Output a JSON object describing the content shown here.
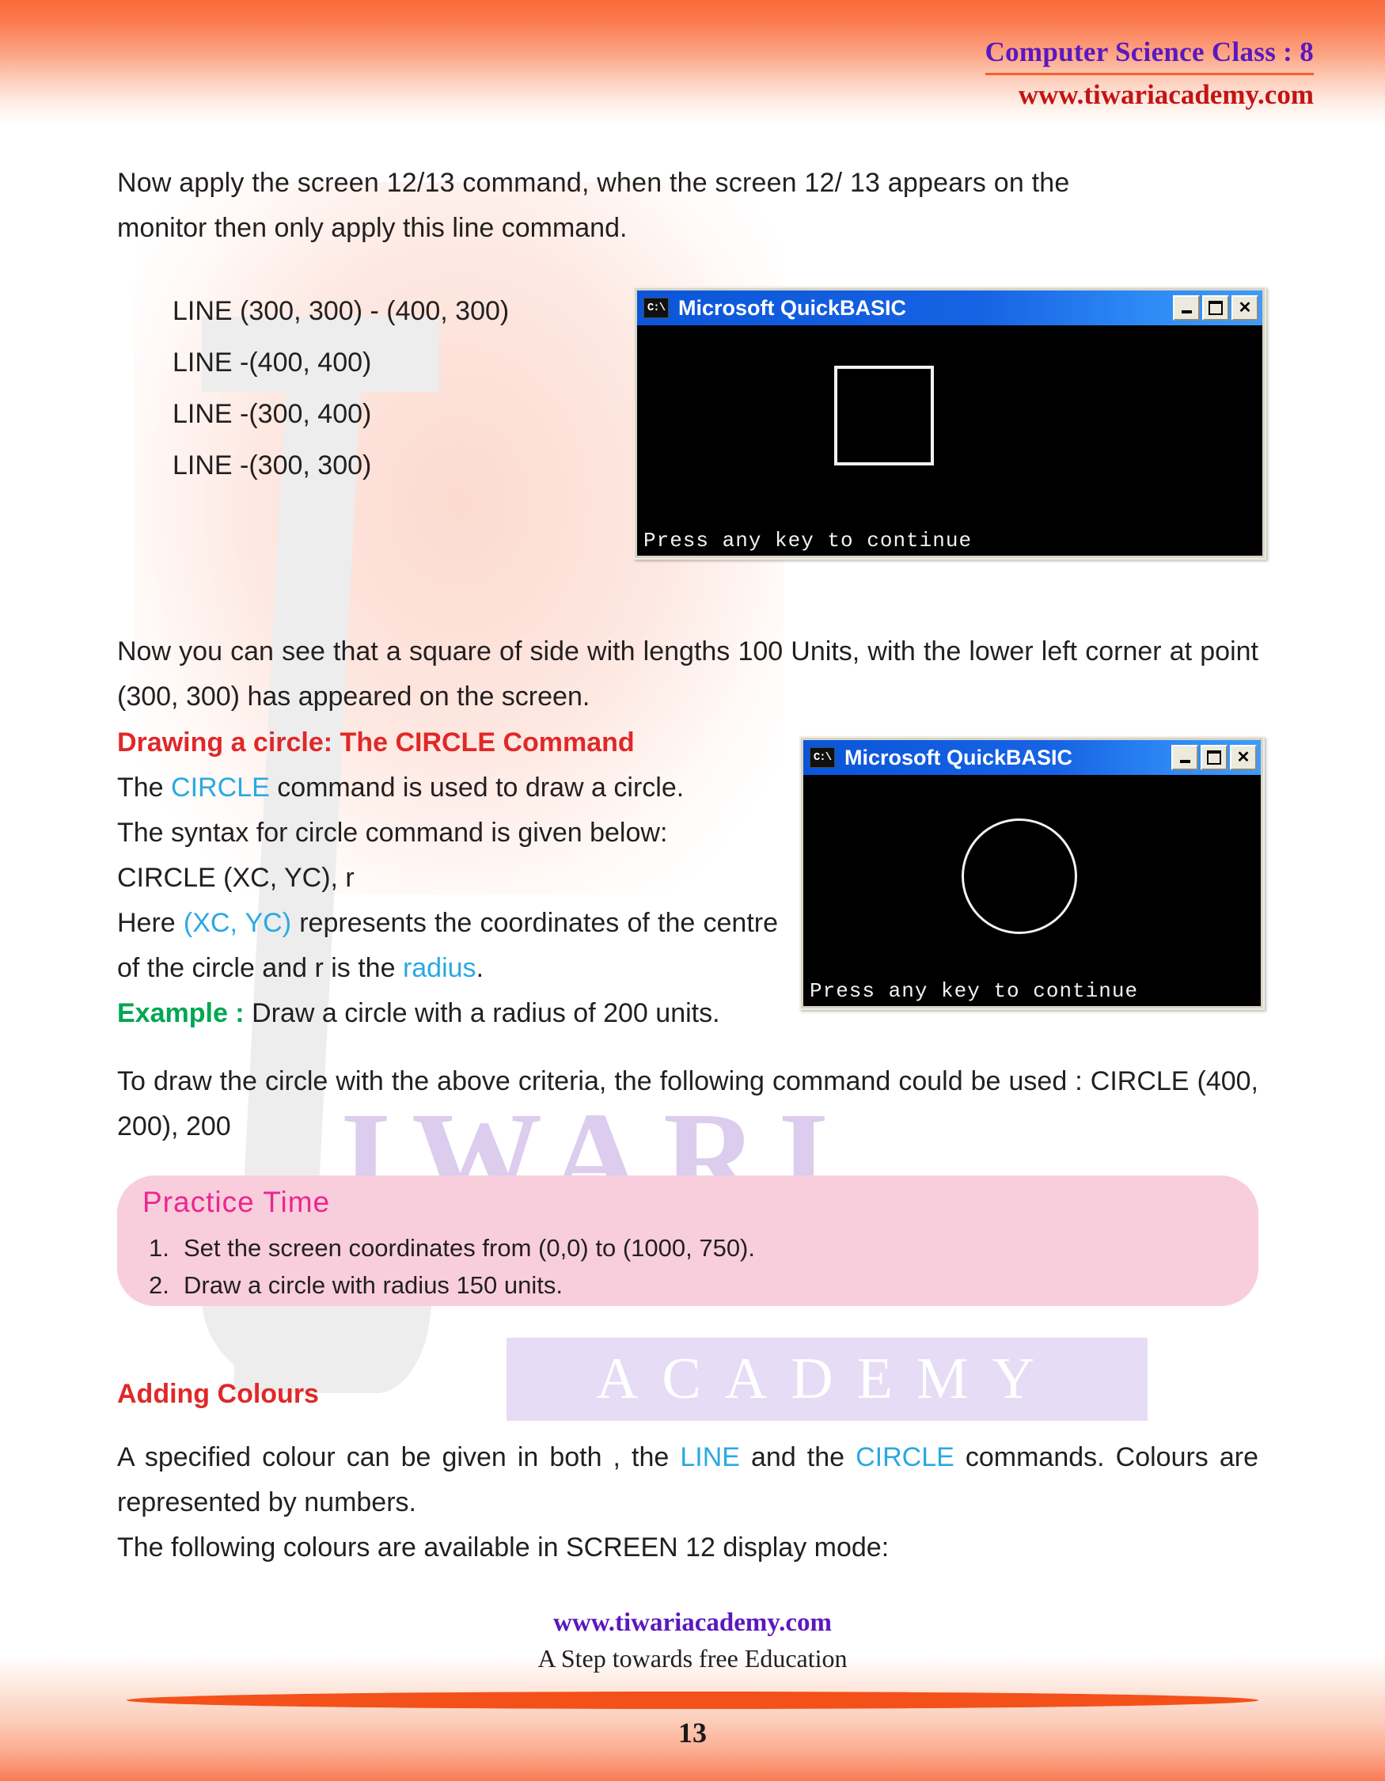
{
  "header": {
    "title": "Computer Science Class : 8",
    "website": "www.tiwariacademy.com"
  },
  "watermark": {
    "letter": "T",
    "word1": "IWARI",
    "word2": "ACADEMY"
  },
  "intro": {
    "line1": "Now  apply  the  screen  12/13    command,  when  the  screen  12/ 13    appears  on  the",
    "line2": "monitor then only apply this line command."
  },
  "line_commands": [
    "LINE (300, 300) - (400, 300)",
    "LINE -(400, 400)",
    "LINE -(300, 400)",
    "LINE -(300, 300)"
  ],
  "square_note": "Now you can see that a square of side with lengths 100 Units, with the lower left corner at point (300, 300) has appeared on the screen.",
  "circle_section": {
    "heading": "Drawing a circle: The CIRCLE Command",
    "p1_pre": "The ",
    "p1_kw": "CIRCLE",
    "p1_post": " command is used to draw a circle.",
    "p2": "The syntax for circle command is given below:",
    "syntax": "CIRCLE (XC, YC), r",
    "p3_pre": "Here ",
    "p3_kw": "(XC, YC)",
    "p3_mid": " represents the coordinates of the centre of the circle and r is the ",
    "p3_kw2": "radius",
    "p3_post": ".",
    "example_label": "Example :",
    "example_text": " Draw a circle with a radius of 200 units.",
    "p4": "To draw the circle with the above criteria, the following command could be used : CIRCLE (400, 200), 200"
  },
  "windows": [
    {
      "title": "Microsoft QuickBASIC",
      "icon": "console-icon",
      "icon_text": "C:\\",
      "status": "Press any key to continue",
      "shape": "rectangle",
      "buttons": [
        "minimize",
        "maximize",
        "close"
      ]
    },
    {
      "title": "Microsoft QuickBASIC",
      "icon": "console-icon",
      "icon_text": "C:\\",
      "status": "Press any key to continue",
      "shape": "circle",
      "buttons": [
        "minimize",
        "maximize",
        "close"
      ]
    }
  ],
  "close_glyph": "✕",
  "practice": {
    "title": "Practice Time",
    "items": [
      {
        "num": "1.",
        "text": "Set the screen coordinates from (0,0) to (1000, 750)."
      },
      {
        "num": "2.",
        "text": "Draw a circle with radius 150 units."
      }
    ]
  },
  "colours_section": {
    "heading": "Adding Colours",
    "p1_a": "A specified colour can be given in both , the ",
    "p1_kw1": "LINE",
    "p1_b": " and the ",
    "p1_kw2": "CIRCLE",
    "p1_c": " commands. Colours are represented by numbers.",
    "p2": "The following colours are available in SCREEN 12 display mode:"
  },
  "footer": {
    "website": "www.tiwariacademy.com",
    "tagline": "A Step towards free Education",
    "page_number": "13"
  },
  "colors": {
    "accent_orange": "#FA6A3A",
    "heading_red": "#E02829",
    "keyword_blue": "#29A9E0",
    "example_green": "#00A651",
    "practice_pink": "#EC268F",
    "brand_purple": "#5B18BE",
    "brand_red": "#C31414"
  }
}
